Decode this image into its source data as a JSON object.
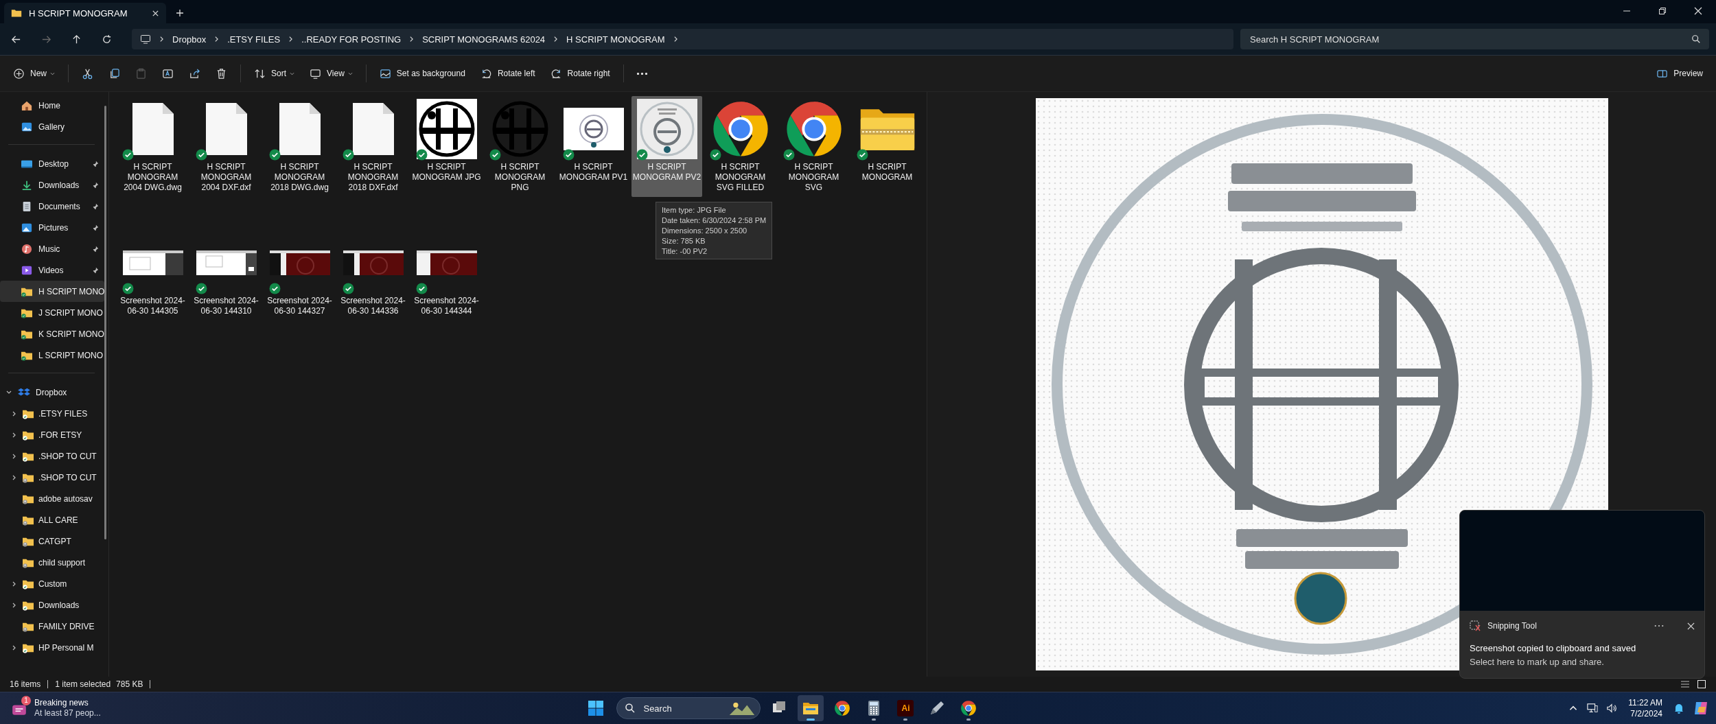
{
  "window": {
    "tab_title": "H SCRIPT MONOGRAM"
  },
  "address": {
    "segments": [
      "Dropbox",
      ".ETSY FILES",
      "..READY FOR POSTING",
      "SCRIPT MONOGRAMS 62024",
      "H SCRIPT MONOGRAM"
    ],
    "search": {
      "placeholder": "Search H SCRIPT MONOGRAM"
    }
  },
  "toolbar": {
    "items": [
      {
        "kind": "new",
        "label": "New",
        "disabled": false
      },
      {
        "kind": "cut",
        "disabled": false
      },
      {
        "kind": "copy",
        "disabled": false
      },
      {
        "kind": "paste",
        "disabled": true
      },
      {
        "kind": "rename",
        "disabled": false
      },
      {
        "kind": "share",
        "disabled": false
      },
      {
        "kind": "delete",
        "disabled": false
      },
      {
        "kind": "sort",
        "label": "Sort",
        "disabled": false
      },
      {
        "kind": "view",
        "label": "View",
        "disabled": false
      },
      {
        "kind": "background",
        "label": "Set as background",
        "disabled": false
      },
      {
        "kind": "rotate-left",
        "label": "Rotate left",
        "disabled": false
      },
      {
        "kind": "rotate-right",
        "label": "Rotate right",
        "disabled": false
      },
      {
        "kind": "more",
        "disabled": false
      }
    ],
    "preview": {
      "label": "Preview"
    }
  },
  "sidebar": {
    "groups": [
      {
        "items": [
          {
            "kind": "home",
            "label": "Home",
            "pinned": false,
            "selected": false
          },
          {
            "kind": "gallery",
            "label": "Gallery",
            "pinned": false,
            "selected": false
          }
        ]
      },
      {
        "items": [
          {
            "kind": "desktop",
            "label": "Desktop",
            "pinned": true,
            "selected": false
          },
          {
            "kind": "downloads",
            "label": "Downloads",
            "pinned": true,
            "selected": false
          },
          {
            "kind": "documents",
            "label": "Documents",
            "pinned": true,
            "selected": false
          },
          {
            "kind": "pictures",
            "label": "Pictures",
            "pinned": true,
            "selected": false
          },
          {
            "kind": "music",
            "label": "Music",
            "pinned": true,
            "selected": false
          },
          {
            "kind": "videos",
            "label": "Videos",
            "pinned": true,
            "selected": false
          },
          {
            "kind": "folder",
            "label": "H SCRIPT MONO",
            "pinned": false,
            "selected": true
          },
          {
            "kind": "folder",
            "label": "J SCRIPT MONO",
            "pinned": false,
            "selected": false
          },
          {
            "kind": "folder",
            "label": "K SCRIPT MONO",
            "pinned": false,
            "selected": false
          },
          {
            "kind": "folder",
            "label": "L SCRIPT MONO",
            "pinned": false,
            "selected": false
          }
        ]
      }
    ],
    "tree": {
      "label": "Dropbox",
      "expanded": true,
      "children": [
        {
          "label": ".ETSY FILES",
          "expandable": true,
          "synced": true
        },
        {
          "label": ".FOR ETSY",
          "expandable": true,
          "synced": true
        },
        {
          "label": ".SHOP TO CUT",
          "expandable": true,
          "synced": true
        },
        {
          "label": ".SHOP TO CUT",
          "expandable": true,
          "synced": false
        },
        {
          "label": "adobe autosav",
          "expandable": false,
          "synced": false
        },
        {
          "label": "ALL CARE",
          "expandable": false,
          "synced": false
        },
        {
          "label": "CATGPT",
          "expandable": false,
          "synced": false
        },
        {
          "label": "child support",
          "expandable": false,
          "synced": false
        },
        {
          "label": "Custom",
          "expandable": true,
          "synced": true
        },
        {
          "label": "Downloads",
          "expandable": true,
          "synced": true
        },
        {
          "label": "FAMILY DRIVE",
          "expandable": false,
          "synced": false
        },
        {
          "label": "HP Personal M",
          "expandable": true,
          "synced": true
        }
      ]
    }
  },
  "files": [
    {
      "name": "H SCRIPT MONOGRAM 2004 DWG.dwg",
      "kind": "document",
      "selected": false
    },
    {
      "name": "H SCRIPT MONOGRAM 2004 DXF.dxf",
      "kind": "document",
      "selected": false
    },
    {
      "name": "H SCRIPT MONOGRAM 2018 DWG.dwg",
      "kind": "document",
      "selected": false
    },
    {
      "name": "H SCRIPT MONOGRAM 2018 DXF.dxf",
      "kind": "document",
      "selected": false
    },
    {
      "name": "H SCRIPT MONOGRAM JPG",
      "kind": "picture",
      "selected": false
    },
    {
      "name": "H SCRIPT MONOGRAM PNG",
      "kind": "picture",
      "selected": false
    },
    {
      "name": "H SCRIPT MONOGRAM PV1",
      "kind": "picture",
      "selected": false
    },
    {
      "name": "H SCRIPT MONOGRAM PV2",
      "kind": "picture",
      "selected": true
    },
    {
      "name": "H SCRIPT MONOGRAM SVG FILLED",
      "kind": "browser",
      "selected": false
    },
    {
      "name": "H SCRIPT MONOGRAM SVG",
      "kind": "browser",
      "selected": false
    },
    {
      "name": "H SCRIPT MONOGRAM",
      "kind": "zip",
      "selected": false
    },
    {
      "name": "Screenshot 2024-06-30 144305",
      "kind": "picture",
      "selected": false
    },
    {
      "name": "Screenshot 2024-06-30 144310",
      "kind": "picture",
      "selected": false
    },
    {
      "name": "Screenshot 2024-06-30 144327",
      "kind": "picture",
      "selected": false
    },
    {
      "name": "Screenshot 2024-06-30 144336",
      "kind": "picture",
      "selected": false
    },
    {
      "name": "Screenshot 2024-06-30 144344",
      "kind": "picture",
      "selected": false
    }
  ],
  "tooltip": {
    "lines": [
      "Item type: JPG File",
      "Date taken: 6/30/2024 2:58 PM",
      "Dimensions: 2500 x 2500",
      "Size: 785 KB",
      "Title: -00 PV2"
    ]
  },
  "status_bar": {
    "count": "16 items",
    "selection": "1 item selected",
    "size": "785 KB"
  },
  "notification": {
    "app": "Snipping Tool",
    "title": "Screenshot copied to clipboard and saved",
    "text": "Select here to mark up and share."
  },
  "taskbar": {
    "news": {
      "badge": "1",
      "title": "Breaking news",
      "text": "At least 87 peop..."
    },
    "search": {
      "placeholder": "Search"
    },
    "apps": [
      {
        "kind": "task-view",
        "active": false,
        "running": false
      },
      {
        "kind": "explorer",
        "active": true,
        "running": true
      },
      {
        "kind": "browser",
        "active": false,
        "running": false
      },
      {
        "kind": "calculator",
        "active": false,
        "running": true
      },
      {
        "kind": "illustrator",
        "label": "Ai",
        "active": false,
        "running": true
      },
      {
        "kind": "pen",
        "active": false,
        "running": false
      },
      {
        "kind": "browser",
        "active": false,
        "running": true
      }
    ],
    "clock": {
      "time": "11:22 AM",
      "date": "7/2/2024"
    }
  }
}
